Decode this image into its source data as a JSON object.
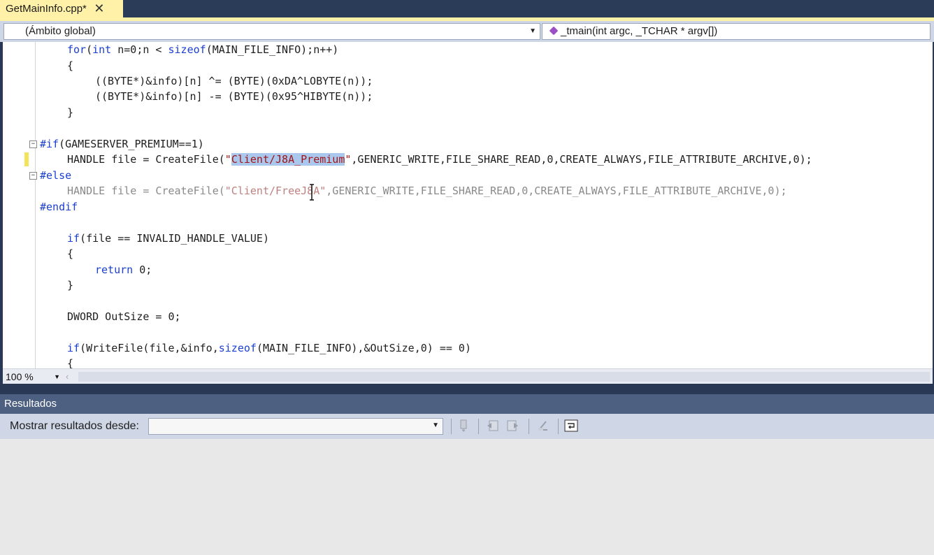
{
  "tab": {
    "filename": "GetMainInfo.cpp*",
    "close_glyph": "✕"
  },
  "nav": {
    "scope": "(Ámbito global)",
    "function": "_tmain(int argc, _TCHAR * argv[])"
  },
  "code": {
    "l1": {
      "a": "for",
      "b": "(",
      "c": "int",
      "d": " n=0;n < ",
      "e": "sizeof",
      "f": "(MAIN_FILE_INFO);n++)"
    },
    "l2": "{",
    "l3": "((BYTE*)&info)[n] ^= (BYTE)(0xDA^LOBYTE(n));",
    "l4": "((BYTE*)&info)[n] -= (BYTE)(0x95^HIBYTE(n));",
    "l5": "}",
    "l7": {
      "a": "#if",
      "b": "(GAMESERVER_PREMIUM==1)"
    },
    "l8": {
      "a": "HANDLE file = CreateFile(",
      "q1": "\"",
      "sel": "Client/J8A_Premium",
      "q2": "\"",
      "b": ",GENERIC_WRITE,FILE_SHARE_READ,0,CREATE_ALWAYS,FILE_ATTRIBUTE_ARCHIVE,0);"
    },
    "l9": "#else",
    "l10": {
      "a": "HANDLE file = CreateFile(",
      "s": "\"Client/FreeJ8A\"",
      "b": ",GENERIC_WRITE,FILE_SHARE_READ,0,CREATE_ALWAYS,FILE_ATTRIBUTE_ARCHIVE,0);"
    },
    "l11": "#endif",
    "l13": {
      "a": "if",
      "b": "(file == INVALID_HANDLE_VALUE)"
    },
    "l14": "{",
    "l15": {
      "a": "return",
      "b": " 0;"
    },
    "l16": "}",
    "l18": "DWORD OutSize = 0;",
    "l20": {
      "a": "if",
      "b": "(WriteFile(file,&info,",
      "c": "sizeof",
      "d": "(MAIN_FILE_INFO),&OutSize,0) == 0)"
    },
    "l21": "{"
  },
  "zoom": {
    "value": "100 %"
  },
  "output": {
    "title": "Resultados",
    "show_label": "Mostrar resultados desde:",
    "source_value": ""
  },
  "colors": {
    "tab_active": "#fff1a8",
    "keyword": "#1a3fd0",
    "string": "#a31515",
    "selection": "#aac8ee",
    "chrome": "#293955"
  }
}
